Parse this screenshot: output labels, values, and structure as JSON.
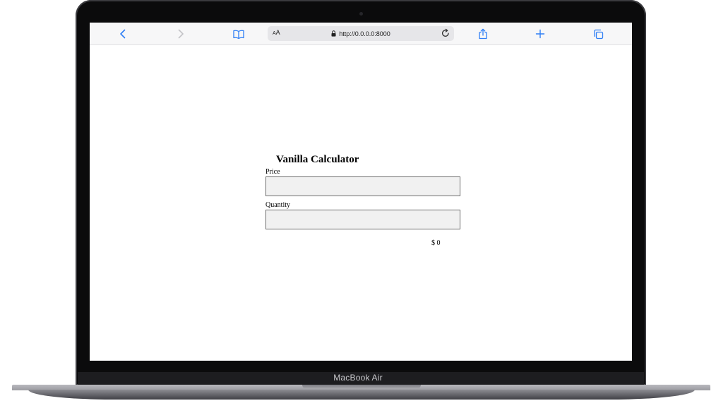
{
  "device": {
    "label": "MacBook Air"
  },
  "browser": {
    "reader_label_small": "A",
    "reader_label_large": "A",
    "url": "http://0.0.0.0:8000",
    "icons": {
      "back": "chevron-left-icon",
      "forward": "chevron-right-icon",
      "bookmarks": "book-icon",
      "lock": "lock-icon",
      "reload": "reload-icon",
      "share": "share-icon",
      "new_tab": "plus-icon",
      "tabs": "tabs-icon"
    },
    "accent_color": "#2f7ff5",
    "forward_enabled": false
  },
  "page": {
    "title": "Vanilla Calculator",
    "price_label": "Price",
    "price_value": "",
    "quantity_label": "Quantity",
    "quantity_value": "",
    "total_currency": "$",
    "total_value": "0"
  }
}
